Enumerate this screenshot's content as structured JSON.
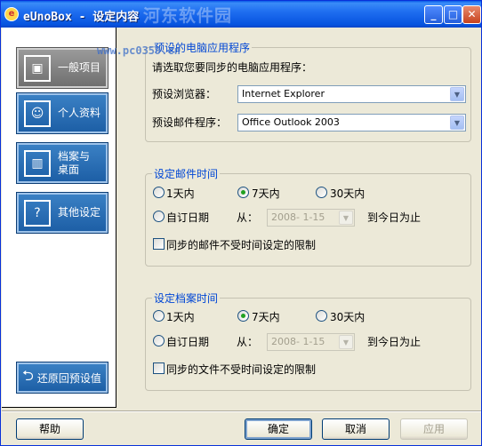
{
  "window": {
    "title": "eUnoBox - 设定内容",
    "watermark": "河东软件园",
    "watermark_url": "www.pc0359.cn",
    "controls": {
      "minimize": "_",
      "maximize": "□",
      "close": "✕"
    }
  },
  "sidebar": {
    "items": [
      {
        "label": "一般项目",
        "icon": "monitor-icon",
        "selected": true
      },
      {
        "label": "个人资料",
        "icon": "profile-card-icon",
        "selected": false
      },
      {
        "label": "档案与\n桌面",
        "icon": "building-icon",
        "selected": false
      },
      {
        "label": "其他设定",
        "icon": "question-icon",
        "selected": false
      }
    ],
    "restore_label": "还原回预设值"
  },
  "apps_group": {
    "legend": "预设的电脑应用程序",
    "prompt": "请选取您要同步的电脑应用程序：",
    "browser_label": "预设浏览器：",
    "browser_value": "Internet Explorer",
    "mail_label": "预设邮件程序：",
    "mail_value": "Office Outlook 2003"
  },
  "mail_time": {
    "legend": "设定邮件时间",
    "options": [
      "1天内",
      "7天内",
      "30天内"
    ],
    "selected": "7天内",
    "custom_label": "自订日期",
    "from_label": "从：",
    "from_value": "2008- 1-15",
    "to_label": "到今日为止",
    "no_limit_label": "同步的邮件不受时间设定的限制",
    "no_limit_checked": false
  },
  "file_time": {
    "legend": "设定档案时间",
    "options": [
      "1天内",
      "7天内",
      "30天内"
    ],
    "selected": "7天内",
    "custom_label": "自订日期",
    "from_label": "从：",
    "from_value": "2008- 1-15",
    "to_label": "到今日为止",
    "no_limit_label": "同步的文件不受时间设定的限制",
    "no_limit_checked": false
  },
  "buttons": {
    "help": "帮助",
    "ok": "确定",
    "cancel": "取消",
    "apply": "应用"
  },
  "colors": {
    "titlebar": "#0a5ae8",
    "legend": "#0046d5",
    "nav_button": "#1d5fa6",
    "nav_selected": "#8a8a8a",
    "radio_dot": "#21a121"
  }
}
